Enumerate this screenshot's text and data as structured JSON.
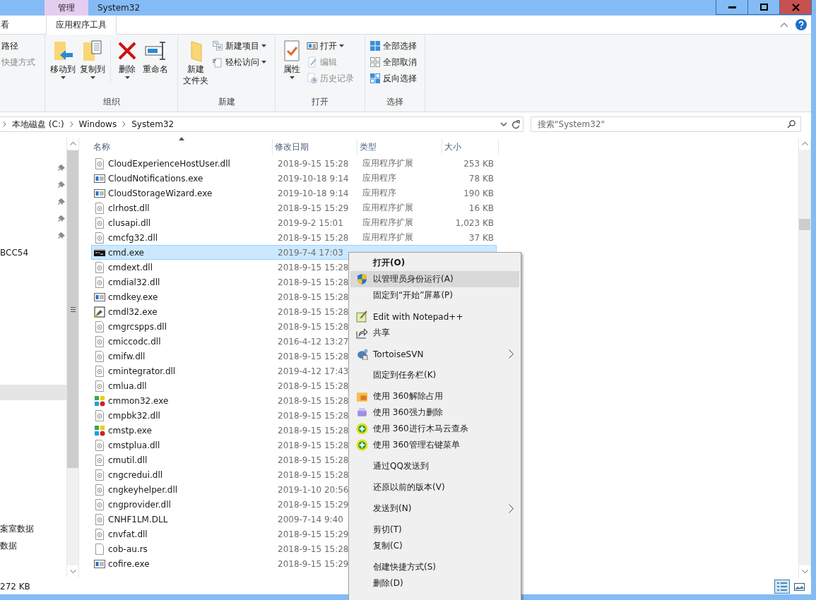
{
  "title_bar": {
    "context_tab": "管理",
    "title": "System32"
  },
  "ribbon_tabs": [
    {
      "label": "看",
      "selected": false
    },
    {
      "label": "应用程序工具",
      "selected": true
    }
  ],
  "ribbon_groups": [
    {
      "items": [
        {
          "kind": "stack",
          "items": [
            {
              "label": "路径",
              "disabled": false
            },
            {
              "label": "快捷方式",
              "disabled": true
            }
          ]
        }
      ]
    },
    {
      "label": "组织",
      "items": [
        {
          "kind": "large",
          "label_lines": [
            "移动到"
          ],
          "dropdown": true
        },
        {
          "kind": "large",
          "label_lines": [
            "复制到"
          ],
          "dropdown": true
        },
        {
          "kind": "divider"
        },
        {
          "kind": "large",
          "label_lines": [
            "删除"
          ],
          "dropdown": true
        },
        {
          "kind": "large",
          "label_lines": [
            "重命名"
          ],
          "dropdown": false
        }
      ]
    },
    {
      "label": "新建",
      "items": [
        {
          "kind": "large",
          "label_lines": [
            "新建",
            "文件夹"
          ],
          "dropdown": false
        },
        {
          "kind": "stack",
          "items": [
            {
              "label": "新建项目",
              "dropdown": true,
              "disabled": false
            },
            {
              "label": "轻松访问",
              "dropdown": true,
              "disabled": false
            }
          ]
        }
      ]
    },
    {
      "label": "打开",
      "items": [
        {
          "kind": "large",
          "label_lines": [
            "属性"
          ],
          "dropdown": true
        },
        {
          "kind": "stack",
          "items": [
            {
              "label": "打开",
              "dropdown": true,
              "disabled": false
            },
            {
              "label": "编辑",
              "dropdown": false,
              "disabled": true
            },
            {
              "label": "历史记录",
              "dropdown": false,
              "disabled": true
            }
          ]
        }
      ]
    },
    {
      "label": "选择",
      "items": [
        {
          "kind": "stack",
          "items": [
            {
              "label": "全部选择",
              "disabled": false
            },
            {
              "label": "全部取消",
              "disabled": false
            },
            {
              "label": "反向选择",
              "disabled": false
            }
          ]
        }
      ]
    }
  ],
  "address_bar": {
    "crumbs": [
      "本地磁盘 (C:)",
      "Windows",
      "System32"
    ]
  },
  "search": {
    "placeholder": "搜索\"System32\""
  },
  "nav": {
    "quick_access": [
      {
        "pinned": true
      },
      {
        "pinned": true
      },
      {
        "pinned": true
      },
      {
        "pinned": true
      },
      {
        "pinned": true
      },
      {
        "label": "BCC54",
        "pinned": false
      }
    ],
    "selected_row": {
      "selected": true
    },
    "lower": [
      {
        "label": "案室数据"
      },
      {
        "label": "数据"
      }
    ]
  },
  "columns": [
    "名称",
    "修改日期",
    "类型",
    "大小"
  ],
  "files": [
    {
      "kind": "dll",
      "name": "CloudExperienceHostUser.dll",
      "date": "2018-9-15 15:28",
      "type": "应用程序扩展",
      "size": "253 KB",
      "selected": false
    },
    {
      "kind": "exe",
      "name": "CloudNotifications.exe",
      "date": "2019-10-18 9:14",
      "type": "应用程序",
      "size": "78 KB",
      "selected": false
    },
    {
      "kind": "exe",
      "name": "CloudStorageWizard.exe",
      "date": "2019-10-18 9:14",
      "type": "应用程序",
      "size": "190 KB",
      "selected": false
    },
    {
      "kind": "dll",
      "name": "clrhost.dll",
      "date": "2018-9-15 15:29",
      "type": "应用程序扩展",
      "size": "16 KB",
      "selected": false
    },
    {
      "kind": "dll",
      "name": "clusapi.dll",
      "date": "2019-9-2 15:01",
      "type": "应用程序扩展",
      "size": "1,023 KB",
      "selected": false
    },
    {
      "kind": "dll",
      "name": "cmcfg32.dll",
      "date": "2018-9-15 15:28",
      "type": "应用程序扩展",
      "size": "37 KB",
      "selected": false
    },
    {
      "kind": "console",
      "name": "cmd.exe",
      "date": "2019-7-4 17:03",
      "selected": true
    },
    {
      "kind": "dll",
      "name": "cmdext.dll",
      "date": "2018-9-15 15:28",
      "selected": false
    },
    {
      "kind": "dll",
      "name": "cmdial32.dll",
      "date": "2018-9-15 15:28",
      "selected": false
    },
    {
      "kind": "exe",
      "name": "cmdkey.exe",
      "date": "2018-9-15 15:28",
      "selected": false
    },
    {
      "kind": "tool",
      "name": "cmdl32.exe",
      "date": "2018-9-15 15:28",
      "selected": false
    },
    {
      "kind": "dll",
      "name": "cmgrcspps.dll",
      "date": "2018-9-15 15:28",
      "selected": false
    },
    {
      "kind": "dll",
      "name": "cmiccodc.dll",
      "date": "2016-4-12 13:27",
      "selected": false
    },
    {
      "kind": "dll",
      "name": "cmifw.dll",
      "date": "2018-9-15 15:28",
      "selected": false
    },
    {
      "kind": "dll",
      "name": "cmintegrator.dll",
      "date": "2019-4-12 17:43",
      "selected": false
    },
    {
      "kind": "dll",
      "name": "cmlua.dll",
      "date": "2018-9-15 15:28",
      "selected": false
    },
    {
      "kind": "colorful",
      "name": "cmmon32.exe",
      "date": "2018-9-15 15:28",
      "selected": false
    },
    {
      "kind": "dll",
      "name": "cmpbk32.dll",
      "date": "2018-9-15 15:28",
      "selected": false
    },
    {
      "kind": "colorful",
      "name": "cmstp.exe",
      "date": "2018-9-15 15:28",
      "selected": false
    },
    {
      "kind": "dll",
      "name": "cmstplua.dll",
      "date": "2018-9-15 15:28",
      "selected": false
    },
    {
      "kind": "dll",
      "name": "cmutil.dll",
      "date": "2018-9-15 15:28",
      "selected": false
    },
    {
      "kind": "dll",
      "name": "cngcredui.dll",
      "date": "2018-9-15 15:28",
      "selected": false
    },
    {
      "kind": "dll",
      "name": "cngkeyhelper.dll",
      "date": "2019-1-10 20:56",
      "selected": false
    },
    {
      "kind": "dll",
      "name": "cngprovider.dll",
      "date": "2018-9-15 15:29",
      "selected": false
    },
    {
      "kind": "dll",
      "name": "CNHF1LM.DLL",
      "date": "2009-7-14 9:40",
      "selected": false
    },
    {
      "kind": "dll",
      "name": "cnvfat.dll",
      "date": "2018-9-15 15:29",
      "selected": false
    },
    {
      "kind": "blank",
      "name": "cob-au.rs",
      "date": "2018-9-15 15:28",
      "selected": false
    },
    {
      "kind": "exe",
      "name": "cofire.exe",
      "date": "2018-9-15 15:29",
      "selected": false
    }
  ],
  "status_bar": {
    "text": "272 KB",
    "views": [
      {
        "kind": "details",
        "selected": true
      },
      {
        "kind": "large-icons",
        "selected": false
      }
    ]
  },
  "context_menu": [
    {
      "kind": "item",
      "label": "打开(O)",
      "bold": true,
      "highlighted": false
    },
    {
      "kind": "item",
      "label": "以管理员身份运行(A)",
      "highlighted": true
    },
    {
      "kind": "item",
      "label": "固定到“开始”屏幕(P)",
      "highlighted": false
    },
    {
      "kind": "separator"
    },
    {
      "kind": "item",
      "label": "Edit with Notepad++",
      "highlighted": false
    },
    {
      "kind": "item",
      "label": "共享",
      "highlighted": false
    },
    {
      "kind": "separator"
    },
    {
      "kind": "item",
      "label": "TortoiseSVN",
      "submenu": true,
      "highlighted": false
    },
    {
      "kind": "separator"
    },
    {
      "kind": "item",
      "label": "固定到任务栏(K)",
      "highlighted": false
    },
    {
      "kind": "separator"
    },
    {
      "kind": "item",
      "label": "使用 360解除占用",
      "highlighted": false
    },
    {
      "kind": "item",
      "label": "使用 360强力删除",
      "highlighted": false
    },
    {
      "kind": "item",
      "label": "使用 360进行木马云查杀",
      "highlighted": false
    },
    {
      "kind": "item",
      "label": "使用 360管理右键菜单",
      "highlighted": false
    },
    {
      "kind": "separator"
    },
    {
      "kind": "item",
      "label": "通过QQ发送到",
      "highlighted": false
    },
    {
      "kind": "separator"
    },
    {
      "kind": "item",
      "label": "还原以前的版本(V)",
      "highlighted": false
    },
    {
      "kind": "separator"
    },
    {
      "kind": "item",
      "label": "发送到(N)",
      "submenu": true,
      "highlighted": false
    },
    {
      "kind": "separator"
    },
    {
      "kind": "item",
      "label": "剪切(T)",
      "highlighted": false
    },
    {
      "kind": "item",
      "label": "复制(C)",
      "highlighted": false
    },
    {
      "kind": "separator"
    },
    {
      "kind": "item",
      "label": "创建快捷方式(S)",
      "highlighted": false
    },
    {
      "kind": "item",
      "label": "删除(D)",
      "highlighted": false
    }
  ]
}
